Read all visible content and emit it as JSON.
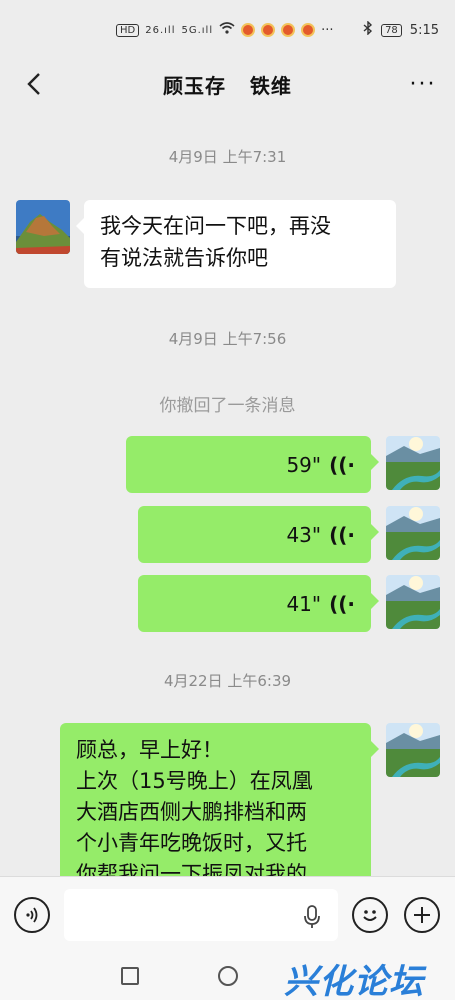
{
  "status_bar": {
    "network_left": "HD",
    "signal1": "26.ıll",
    "signal2": "5G.ıll",
    "dots": "···",
    "battery": "78",
    "time": "5:15"
  },
  "header": {
    "back_icon": "‹",
    "title": "顾玉存   铁维",
    "more_icon": "···"
  },
  "messages": {
    "time1": "4月9日 上午7:31",
    "incoming_text": "我今天在问一下吧，再没\n有说法就告诉你吧",
    "time2": "4月9日 上午7:56",
    "notice": "你撤回了一条消息",
    "voice1": "59\"",
    "voice2": "43\"",
    "voice3": "41\"",
    "time3": "4月22日 上午6:39",
    "outgoing_text": "顾总，早上好！\n上次（15号晚上）在凤凰\n大酒店西侧大鹏排档和两\n个小青年吃晚饭时，又托\n你帮我问一下振凤对我的"
  },
  "input_bar": {
    "voice_icon": "voice-mode-icon",
    "emoji_icon": "emoji-icon",
    "plus_icon": "add-icon"
  },
  "nav_bar": {
    "watermark": "兴化论坛"
  },
  "colors": {
    "out_bubble": "#95ec69",
    "in_bubble": "#ffffff",
    "background": "#ededed"
  }
}
